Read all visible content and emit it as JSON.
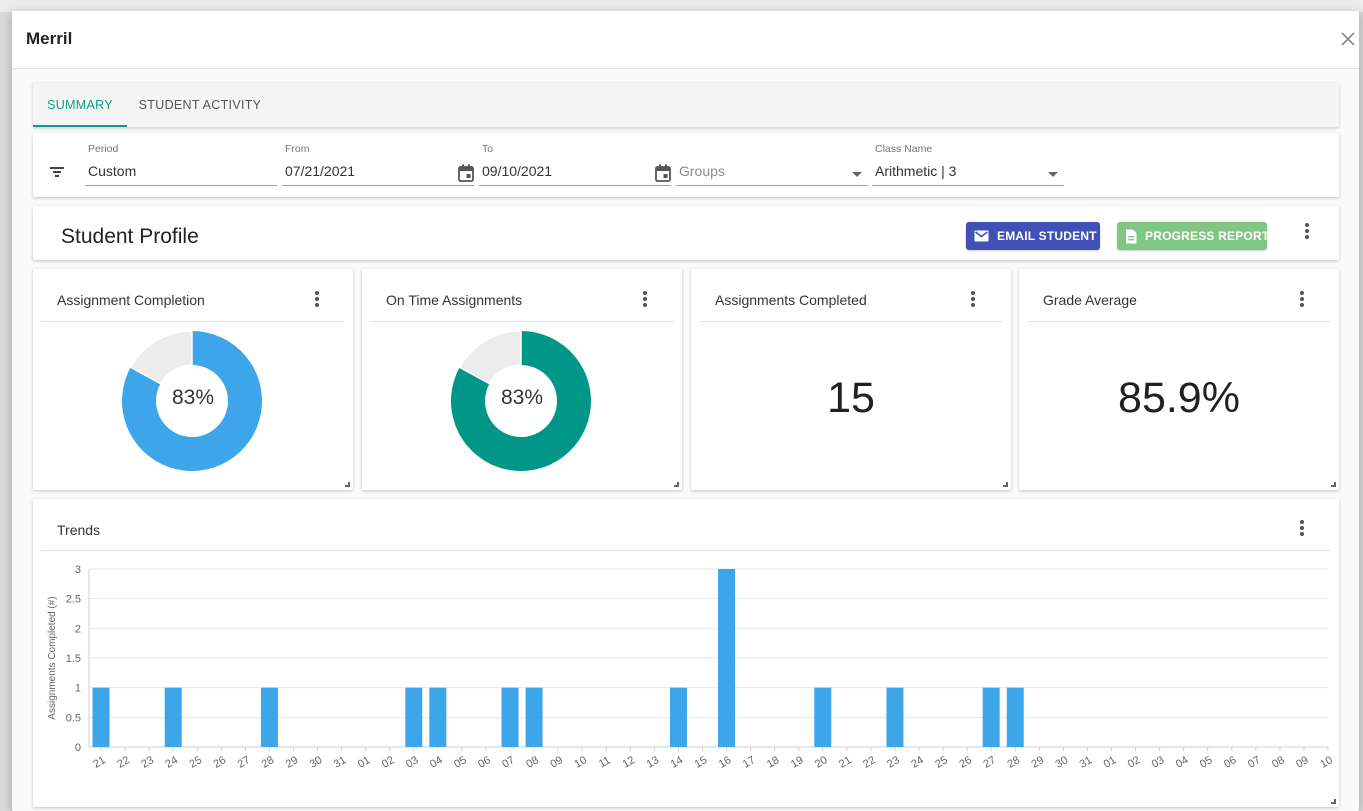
{
  "modal": {
    "title": "Merril"
  },
  "tabs": [
    {
      "label": "Summary",
      "active": true
    },
    {
      "label": "Student Activity",
      "active": false
    }
  ],
  "filters": {
    "period": {
      "label": "Period",
      "value": "Custom"
    },
    "from": {
      "label": "From",
      "value": "07/21/2021"
    },
    "to": {
      "label": "To",
      "value": "09/10/2021"
    },
    "groups": {
      "placeholder": "Groups"
    },
    "class_name": {
      "label": "Class Name",
      "value": "Arithmetic | 3"
    }
  },
  "profile": {
    "title": "Student Profile",
    "email_button": "Email Student",
    "report_button": "Progress Report"
  },
  "metrics": [
    {
      "title": "Assignment Completion",
      "value": "83%",
      "percent": 83,
      "color": "#3da5ea"
    },
    {
      "title": "On Time Assignments",
      "value": "83%",
      "percent": 83,
      "color": "#009688"
    },
    {
      "title": "Assignments Completed",
      "value": "15"
    },
    {
      "title": "Grade Average",
      "value": "85.9%"
    }
  ],
  "trends": {
    "title": "Trends",
    "chart_data": {
      "type": "bar",
      "ylabel": "Assignments Completed (#)",
      "ylim": [
        0,
        3
      ],
      "yticks": [
        "0",
        "0.5",
        "1",
        "1.5",
        "2",
        "2.5",
        "3"
      ],
      "categories": [
        "21",
        "22",
        "23",
        "24",
        "25",
        "26",
        "27",
        "28",
        "29",
        "30",
        "31",
        "01",
        "02",
        "03",
        "04",
        "05",
        "06",
        "07",
        "08",
        "09",
        "10",
        "11",
        "12",
        "13",
        "14",
        "15",
        "16",
        "17",
        "18",
        "19",
        "20",
        "21",
        "22",
        "23",
        "24",
        "25",
        "26",
        "27",
        "28",
        "29",
        "30",
        "31",
        "01",
        "02",
        "03",
        "04",
        "05",
        "06",
        "07",
        "08",
        "09",
        "10"
      ],
      "values": [
        1,
        0,
        0,
        1,
        0,
        0,
        0,
        1,
        0,
        0,
        0,
        0,
        0,
        1,
        1,
        0,
        0,
        1,
        1,
        0,
        0,
        0,
        0,
        0,
        1,
        0,
        3,
        0,
        0,
        0,
        1,
        0,
        0,
        1,
        0,
        0,
        0,
        1,
        1,
        0,
        0,
        0,
        0,
        0,
        0,
        0,
        0,
        0,
        0,
        0,
        0,
        0
      ],
      "color": "#3da5ea",
      "grid": true
    }
  },
  "colors": {
    "accent": "#0f9b8b",
    "email_button": "#3f51b5",
    "report_button": "#81c784",
    "bar": "#3da5ea"
  }
}
